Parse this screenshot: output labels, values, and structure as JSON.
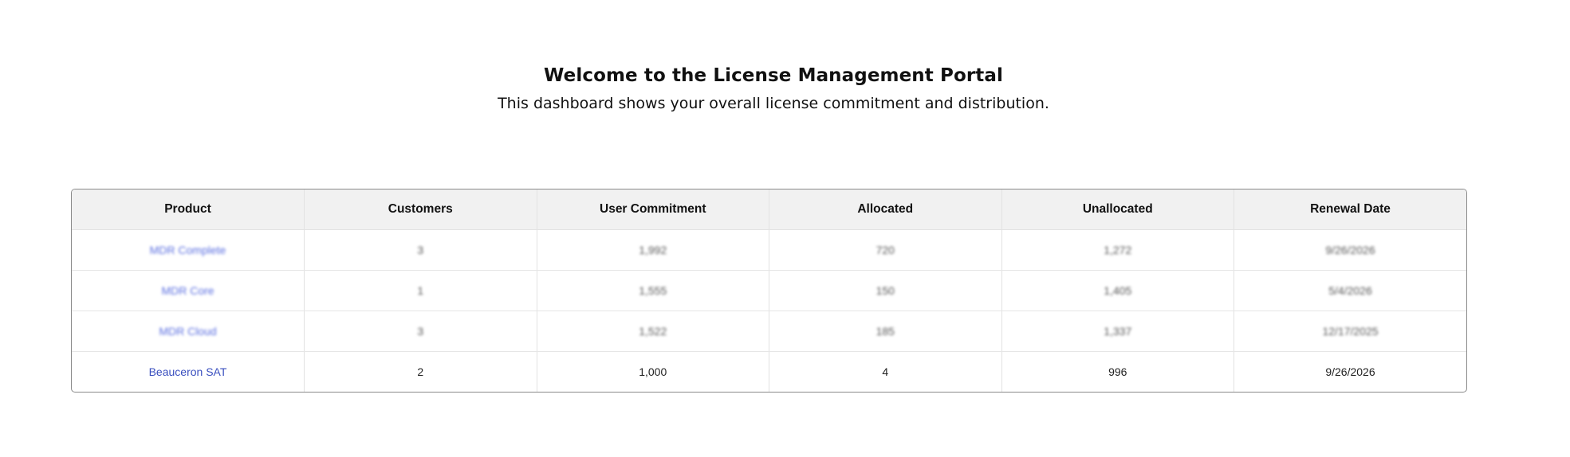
{
  "header": {
    "title": "Welcome to the License Management Portal",
    "subtitle": "This dashboard shows your overall license commitment and distribution."
  },
  "table": {
    "columns": [
      "Product",
      "Customers",
      "User Commitment",
      "Allocated",
      "Unallocated",
      "Renewal Date"
    ],
    "rows": [
      {
        "product": "MDR Complete",
        "customers": "3",
        "commitment": "1,992",
        "allocated": "720",
        "unallocated": "1,272",
        "renewal": "9/26/2026",
        "blurred": true
      },
      {
        "product": "MDR Core",
        "customers": "1",
        "commitment": "1,555",
        "allocated": "150",
        "unallocated": "1,405",
        "renewal": "5/4/2026",
        "blurred": true
      },
      {
        "product": "MDR Cloud",
        "customers": "3",
        "commitment": "1,522",
        "allocated": "185",
        "unallocated": "1,337",
        "renewal": "12/17/2025",
        "blurred": true
      },
      {
        "product": "Beauceron SAT",
        "customers": "2",
        "commitment": "1,000",
        "allocated": "4",
        "unallocated": "996",
        "renewal": "9/26/2026",
        "blurred": false
      }
    ]
  },
  "colors": {
    "link": "#3a4fbf",
    "header_bg": "#f1f1f1",
    "border": "#8a8a8a"
  }
}
